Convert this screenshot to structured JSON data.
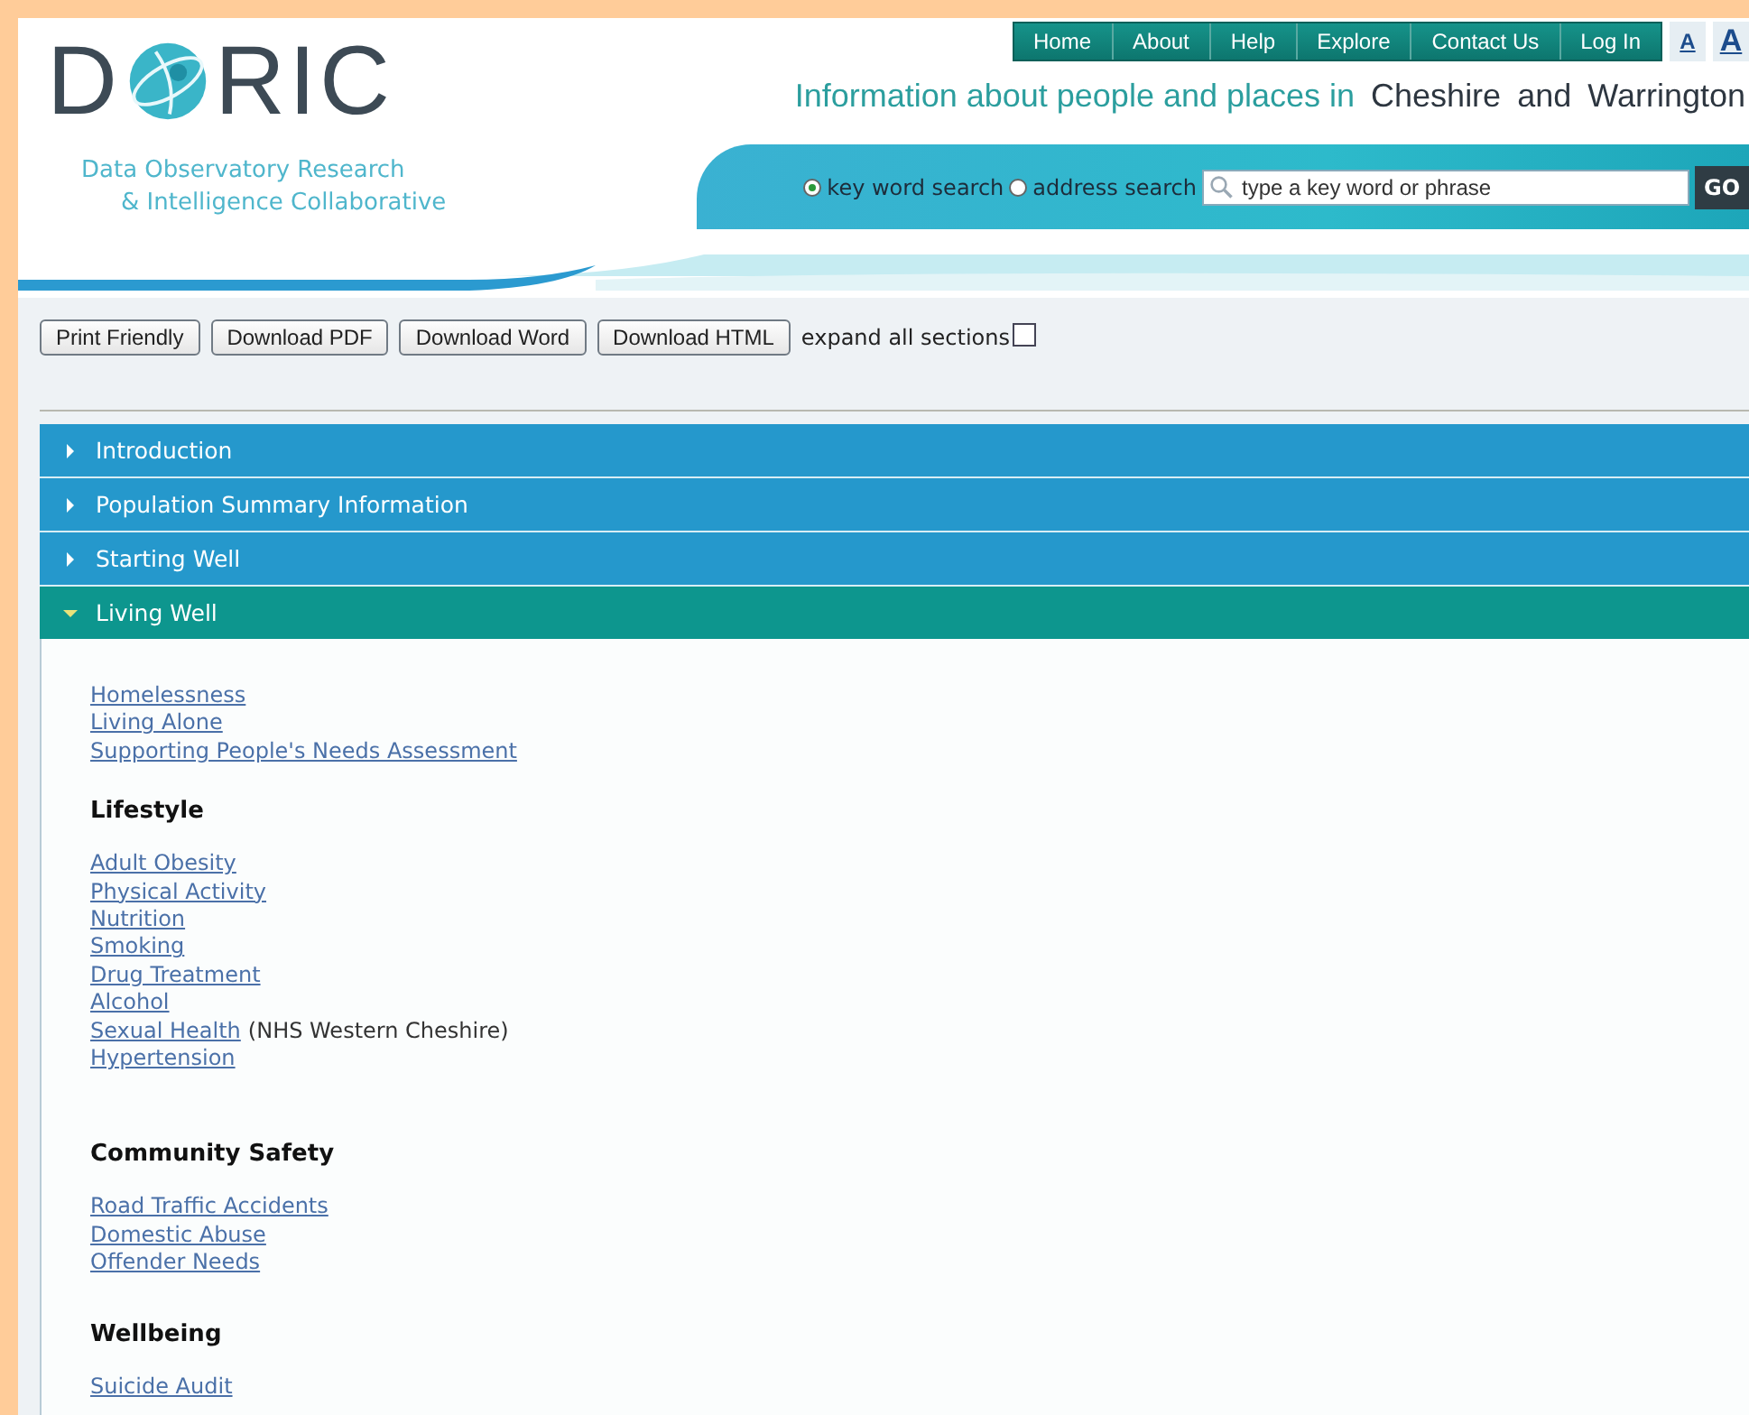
{
  "logo": {
    "before": "D",
    "after": "RIC",
    "subtitle": [
      "Data Observatory Research",
      "& Intelligence Collaborative"
    ]
  },
  "nav": [
    "Home",
    "About",
    "Help",
    "Explore",
    "Contact Us",
    "Log In"
  ],
  "font_sizes": [
    {
      "label": "A",
      "kind": "small"
    },
    {
      "label": "A",
      "kind": "large"
    }
  ],
  "tagline": {
    "lead": "Information about people and places in",
    "places": [
      "Cheshire",
      "and",
      "Warrington"
    ]
  },
  "search": {
    "modes": [
      {
        "label": "key word search",
        "selected": true
      },
      {
        "label": "address search",
        "selected": false
      }
    ],
    "placeholder": "type a key word or phrase",
    "go": "GO"
  },
  "toolbar": {
    "buttons": [
      "Print Friendly",
      "Download PDF",
      "Download Word",
      "Download HTML"
    ],
    "expand_all": {
      "label": "expand all sections",
      "checked": false
    }
  },
  "sections": [
    {
      "title": "Introduction",
      "expanded": false
    },
    {
      "title": "Population Summary Information",
      "expanded": false
    },
    {
      "title": "Starting Well",
      "expanded": false
    },
    {
      "title": "Living Well",
      "expanded": true
    }
  ],
  "content": [
    {
      "items": [
        {
          "link": "Homelessness"
        },
        {
          "link": "Living Alone"
        },
        {
          "link": "Supporting People's Needs Assessment"
        }
      ]
    },
    {
      "heading": "Lifestyle",
      "items": [
        {
          "link": "Adult Obesity"
        },
        {
          "link": "Physical Activity"
        },
        {
          "link": "Nutrition"
        },
        {
          "link": "Smoking"
        },
        {
          "link": "Drug Treatment"
        },
        {
          "link": "Alcohol"
        },
        {
          "link": "Sexual Health",
          "note": "(NHS Western Cheshire)"
        },
        {
          "link": "Hypertension"
        }
      ]
    },
    {
      "heading": "Community Safety",
      "items": [
        {
          "link": "Road Traffic Accidents"
        },
        {
          "link": "Domestic Abuse"
        },
        {
          "link": "Offender Needs"
        }
      ]
    },
    {
      "heading": "Wellbeing",
      "items": [
        {
          "link": "Suicide Audit"
        }
      ]
    }
  ]
}
